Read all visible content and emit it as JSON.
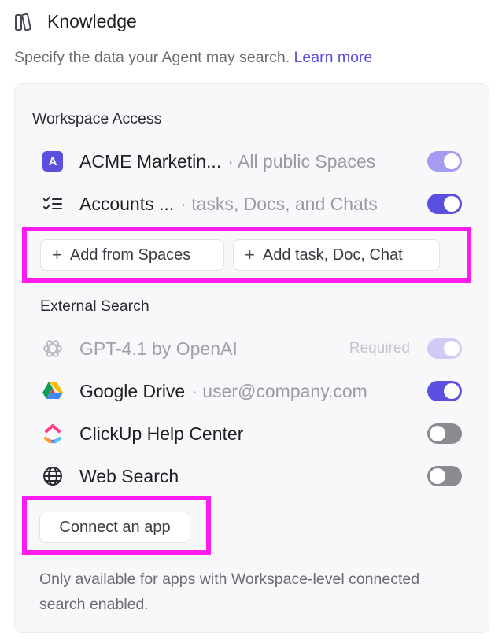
{
  "header": {
    "title": "Knowledge",
    "subtitle": "Specify the data your Agent may search.",
    "learn_more": "Learn more"
  },
  "workspace": {
    "title": "Workspace Access",
    "items": [
      {
        "name": "ACME Marketin...",
        "meta": "· All public Spaces",
        "toggle": "on",
        "icon": "acme-space-avatar-icon",
        "badge": "A"
      },
      {
        "name": "Accounts ...",
        "meta": "· tasks, Docs, and Chats",
        "toggle": "on",
        "icon": "checklist-icon"
      }
    ],
    "buttons": {
      "add_from_spaces": "Add from Spaces",
      "add_task": "Add task, Doc, Chat"
    }
  },
  "external": {
    "title": "External Search",
    "items": [
      {
        "name": "GPT-4.1 by OpenAI",
        "meta": "",
        "required": "Required",
        "toggle": "on-disabled",
        "icon": "openai-icon"
      },
      {
        "name": "Google Drive",
        "meta": "· user@company.com",
        "toggle": "on",
        "icon": "google-drive-icon"
      },
      {
        "name": "ClickUp Help Center",
        "meta": "",
        "toggle": "off",
        "icon": "clickup-icon"
      },
      {
        "name": "Web Search",
        "meta": "",
        "toggle": "off",
        "icon": "globe-icon"
      }
    ],
    "connect_app": "Connect an app",
    "note": "Only available for apps with Workspace-level connected search enabled."
  },
  "colors": {
    "accent": "#5b4fe0",
    "highlight": "#ff1af0",
    "toggle_off": "#8a8a91"
  }
}
